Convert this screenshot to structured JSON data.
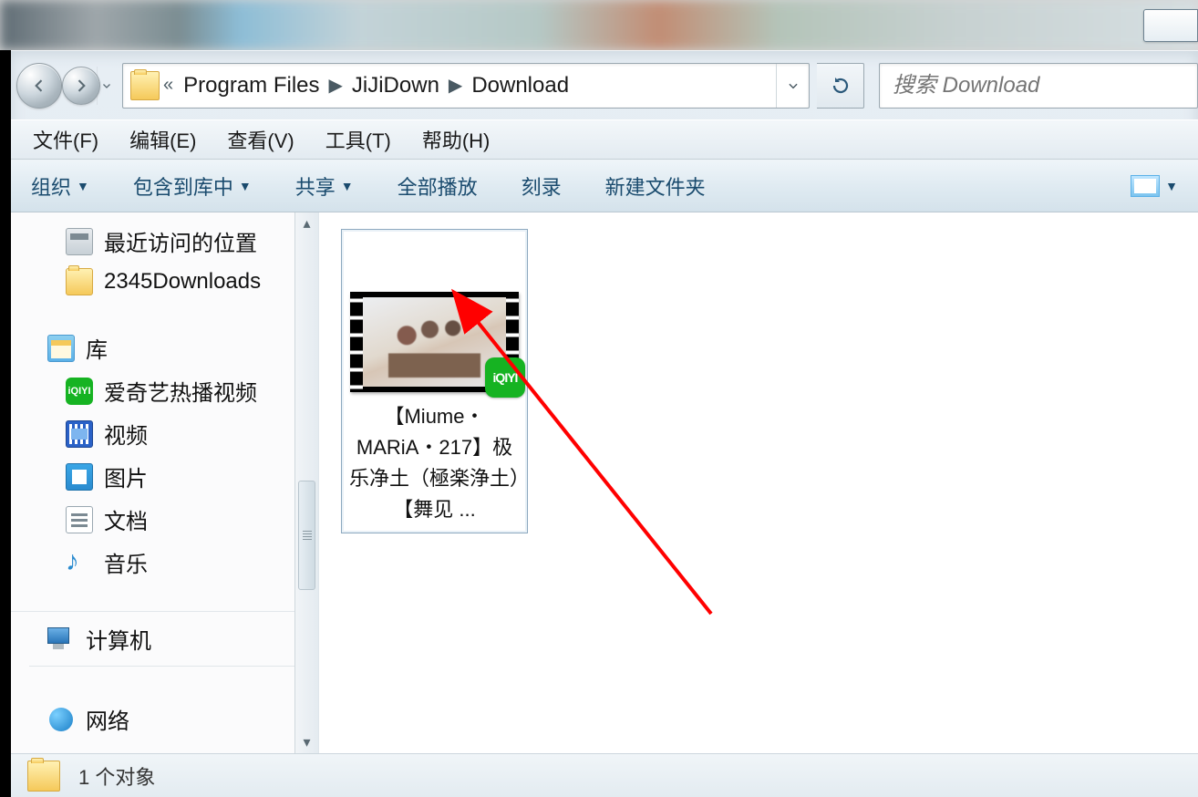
{
  "breadcrumb": {
    "segments": [
      "Program Files",
      "JiJiDown",
      "Download"
    ]
  },
  "search": {
    "placeholder": "搜索 Download"
  },
  "menu": {
    "file": "文件(F)",
    "edit": "编辑(E)",
    "view": "查看(V)",
    "tools": "工具(T)",
    "help": "帮助(H)"
  },
  "toolbar": {
    "organize": "组织",
    "include_in_lib": "包含到库中",
    "share": "共享",
    "play_all": "全部播放",
    "burn": "刻录",
    "new_folder": "新建文件夹"
  },
  "sidebar": {
    "recent_places": "最近访问的位置",
    "downloads_2345": "2345Downloads",
    "libraries": "库",
    "iqiyi_videos": "爱奇艺热播视频",
    "videos": "视频",
    "pictures": "图片",
    "documents": "文档",
    "music": "音乐",
    "computer": "计算机",
    "network": "网络"
  },
  "iqiyi_badge_text": "iQIYI",
  "content": {
    "file_title": "【Miume・MARiA・217】极乐净土（極楽浄土）【舞见 ..."
  },
  "status": {
    "object_count": "1 个对象"
  }
}
